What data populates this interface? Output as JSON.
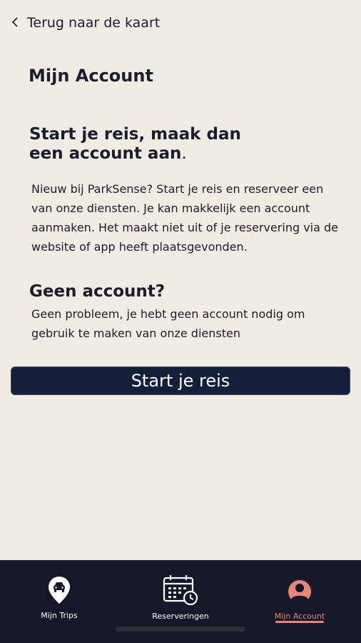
{
  "nav": {
    "back_label": "Terug naar de kaart"
  },
  "page": {
    "title": "Mijn Account"
  },
  "section1": {
    "heading": "Start je reis, maak dan een account aan",
    "heading_dot": ".",
    "body": "Nieuw bij ParkSense? Start je reis en reserveer een van onze diensten. Je kan makkelijk een account aanmaken. Het maakt niet uit of je reservering via de website of app heeft plaatsgevonden."
  },
  "section2": {
    "heading": "Geen account?",
    "body": "Geen probleem, je hebt geen account nodig om gebruik te maken van onze diensten"
  },
  "cta": {
    "label": "Start je reis"
  },
  "tabbar": {
    "items": [
      {
        "label": "Mijn Trips",
        "icon": "map-pin-car-icon",
        "active": false
      },
      {
        "label": "Reserveringen",
        "icon": "calendar-clock-icon",
        "active": false
      },
      {
        "label": "Mijn Account",
        "icon": "user-circle-icon",
        "active": true
      }
    ]
  },
  "colors": {
    "background": "#f0ebe3",
    "text": "#1a1d2e",
    "button": "#14203a",
    "tabbar": "#151828",
    "accent": "#e8847a"
  }
}
